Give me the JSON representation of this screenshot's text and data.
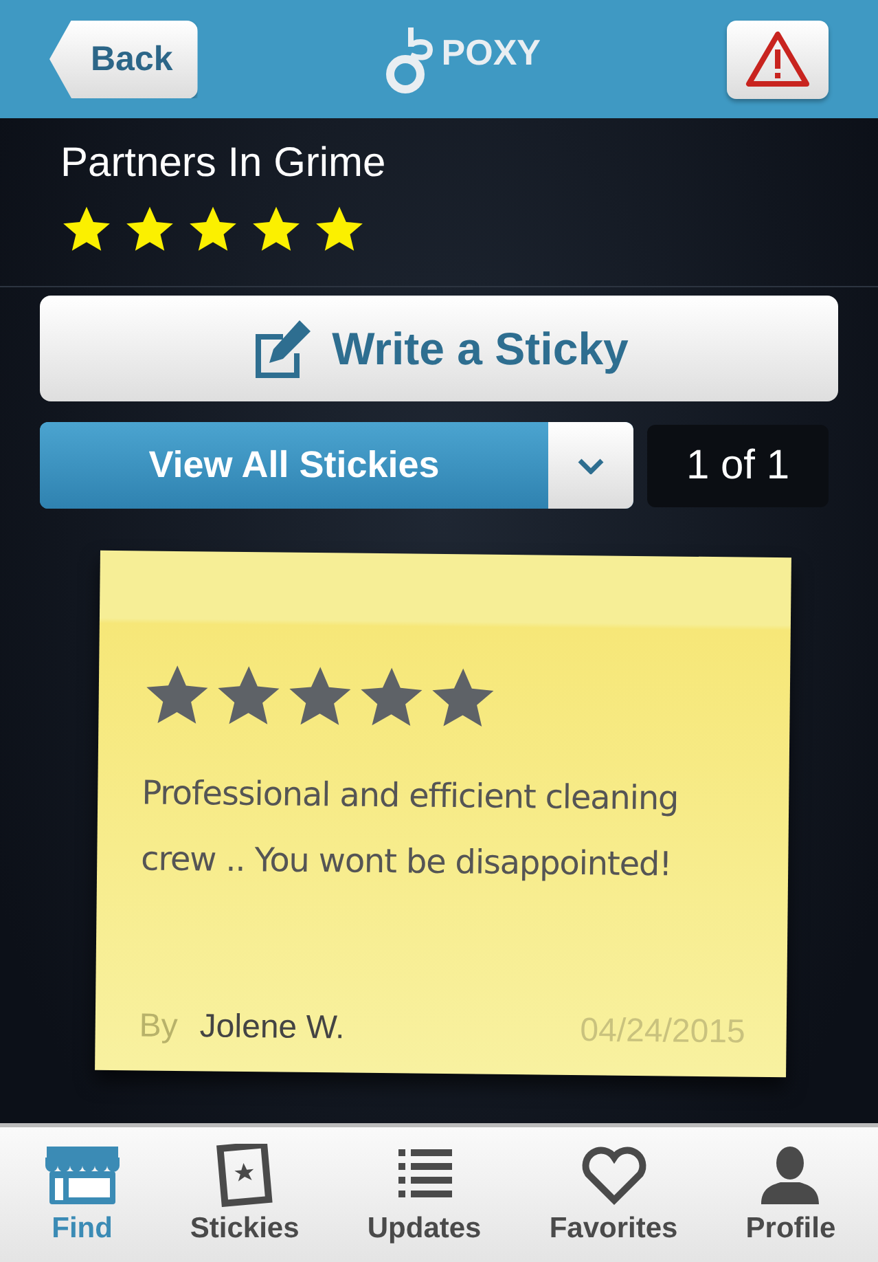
{
  "header": {
    "back": "Back",
    "logo": "POXY"
  },
  "business": {
    "name": "Partners In Grime",
    "stars": 5
  },
  "write_button": "Write a Sticky",
  "filter": {
    "label": "View All Stickies",
    "pager": "1 of 1"
  },
  "sticky": {
    "stars": 5,
    "text": "Professional and efficient cleaning crew .. You wont be disappointed!",
    "by": "By",
    "author": "Jolene W.",
    "date": "04/24/2015"
  },
  "tabs": [
    {
      "label": "Find",
      "kind": "store",
      "selected": true
    },
    {
      "label": "Stickies",
      "kind": "sticky",
      "selected": false
    },
    {
      "label": "Updates",
      "kind": "list",
      "selected": false
    },
    {
      "label": "Favorites",
      "kind": "heart",
      "selected": false
    },
    {
      "label": "Profile",
      "kind": "person",
      "selected": false
    }
  ]
}
